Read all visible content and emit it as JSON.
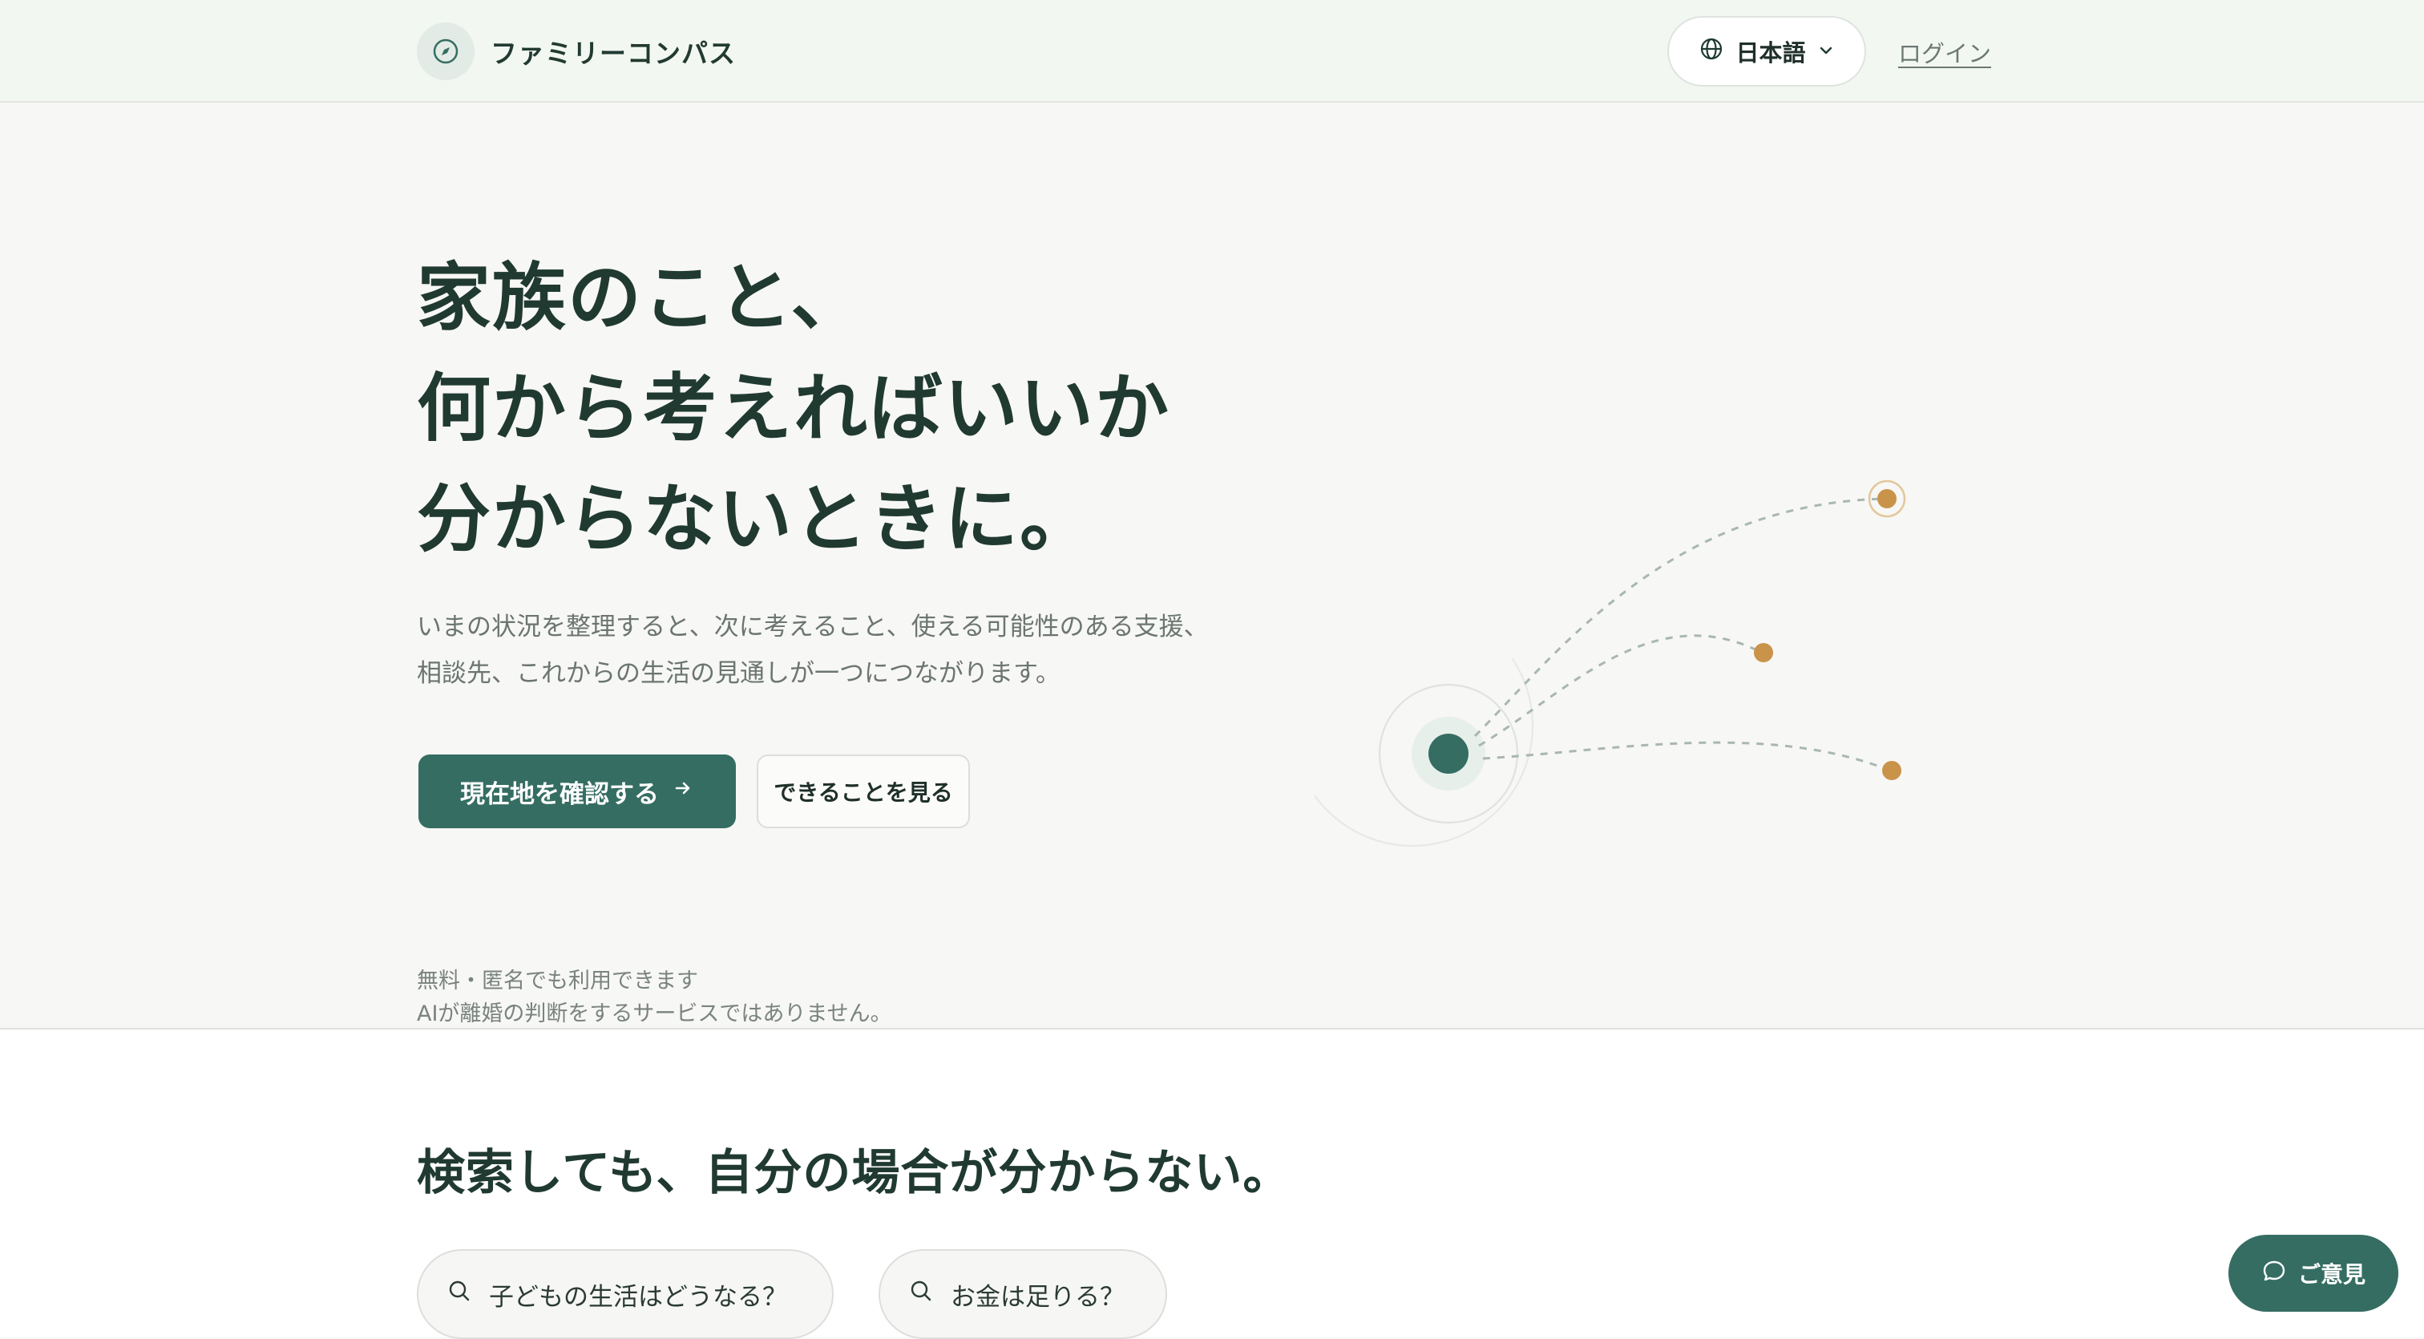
{
  "header": {
    "brand_name": "ファミリーコンパス",
    "language_label": "日本語",
    "login_label": "ログイン"
  },
  "hero": {
    "title_lines": [
      "家族のこと、",
      "何から考えればいいか",
      "分からないときに。"
    ],
    "description_lines": [
      "いまの状況を整理すると、次に考えること、使える可能性のある支援、",
      "相談先、これからの生活の見通しが一つにつながります。"
    ],
    "primary_button": "現在地を確認する",
    "secondary_button": "できることを見る",
    "notes": [
      "無料・匿名でも利用できます",
      "AIが離婚の判断をするサービスではありません。"
    ]
  },
  "section2": {
    "title": "検索しても、自分の場合が分からない。",
    "chips": [
      "子どもの生活はどうなる？",
      "お金は足りる？"
    ]
  },
  "feedback": {
    "label": "ご意見"
  },
  "icons": {
    "brand": "compass-icon",
    "language": "globe-icon",
    "dropdown": "chevron-down-icon",
    "primary_arrow": "arrow-right-icon",
    "chip": "search-icon",
    "feedback": "chat-bubble-icon"
  },
  "colors": {
    "accent": "#356d62",
    "accent_light": "#e2ebe5",
    "dot": "#c9934a",
    "heading": "#203a31",
    "muted": "#6b7571"
  }
}
